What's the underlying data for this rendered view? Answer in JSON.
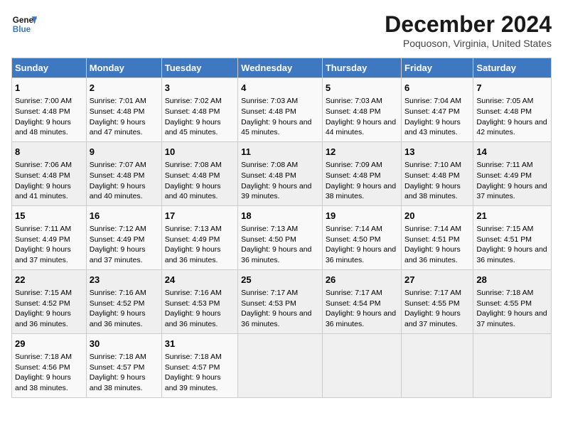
{
  "header": {
    "logo_line1": "General",
    "logo_line2": "Blue",
    "title": "December 2024",
    "subtitle": "Poquoson, Virginia, United States"
  },
  "days_of_week": [
    "Sunday",
    "Monday",
    "Tuesday",
    "Wednesday",
    "Thursday",
    "Friday",
    "Saturday"
  ],
  "weeks": [
    [
      {
        "day": "1",
        "sunrise": "Sunrise: 7:00 AM",
        "sunset": "Sunset: 4:48 PM",
        "daylight": "Daylight: 9 hours and 48 minutes."
      },
      {
        "day": "2",
        "sunrise": "Sunrise: 7:01 AM",
        "sunset": "Sunset: 4:48 PM",
        "daylight": "Daylight: 9 hours and 47 minutes."
      },
      {
        "day": "3",
        "sunrise": "Sunrise: 7:02 AM",
        "sunset": "Sunset: 4:48 PM",
        "daylight": "Daylight: 9 hours and 45 minutes."
      },
      {
        "day": "4",
        "sunrise": "Sunrise: 7:03 AM",
        "sunset": "Sunset: 4:48 PM",
        "daylight": "Daylight: 9 hours and 45 minutes."
      },
      {
        "day": "5",
        "sunrise": "Sunrise: 7:03 AM",
        "sunset": "Sunset: 4:48 PM",
        "daylight": "Daylight: 9 hours and 44 minutes."
      },
      {
        "day": "6",
        "sunrise": "Sunrise: 7:04 AM",
        "sunset": "Sunset: 4:47 PM",
        "daylight": "Daylight: 9 hours and 43 minutes."
      },
      {
        "day": "7",
        "sunrise": "Sunrise: 7:05 AM",
        "sunset": "Sunset: 4:48 PM",
        "daylight": "Daylight: 9 hours and 42 minutes."
      }
    ],
    [
      {
        "day": "8",
        "sunrise": "Sunrise: 7:06 AM",
        "sunset": "Sunset: 4:48 PM",
        "daylight": "Daylight: 9 hours and 41 minutes."
      },
      {
        "day": "9",
        "sunrise": "Sunrise: 7:07 AM",
        "sunset": "Sunset: 4:48 PM",
        "daylight": "Daylight: 9 hours and 40 minutes."
      },
      {
        "day": "10",
        "sunrise": "Sunrise: 7:08 AM",
        "sunset": "Sunset: 4:48 PM",
        "daylight": "Daylight: 9 hours and 40 minutes."
      },
      {
        "day": "11",
        "sunrise": "Sunrise: 7:08 AM",
        "sunset": "Sunset: 4:48 PM",
        "daylight": "Daylight: 9 hours and 39 minutes."
      },
      {
        "day": "12",
        "sunrise": "Sunrise: 7:09 AM",
        "sunset": "Sunset: 4:48 PM",
        "daylight": "Daylight: 9 hours and 38 minutes."
      },
      {
        "day": "13",
        "sunrise": "Sunrise: 7:10 AM",
        "sunset": "Sunset: 4:48 PM",
        "daylight": "Daylight: 9 hours and 38 minutes."
      },
      {
        "day": "14",
        "sunrise": "Sunrise: 7:11 AM",
        "sunset": "Sunset: 4:49 PM",
        "daylight": "Daylight: 9 hours and 37 minutes."
      }
    ],
    [
      {
        "day": "15",
        "sunrise": "Sunrise: 7:11 AM",
        "sunset": "Sunset: 4:49 PM",
        "daylight": "Daylight: 9 hours and 37 minutes."
      },
      {
        "day": "16",
        "sunrise": "Sunrise: 7:12 AM",
        "sunset": "Sunset: 4:49 PM",
        "daylight": "Daylight: 9 hours and 37 minutes."
      },
      {
        "day": "17",
        "sunrise": "Sunrise: 7:13 AM",
        "sunset": "Sunset: 4:49 PM",
        "daylight": "Daylight: 9 hours and 36 minutes."
      },
      {
        "day": "18",
        "sunrise": "Sunrise: 7:13 AM",
        "sunset": "Sunset: 4:50 PM",
        "daylight": "Daylight: 9 hours and 36 minutes."
      },
      {
        "day": "19",
        "sunrise": "Sunrise: 7:14 AM",
        "sunset": "Sunset: 4:50 PM",
        "daylight": "Daylight: 9 hours and 36 minutes."
      },
      {
        "day": "20",
        "sunrise": "Sunrise: 7:14 AM",
        "sunset": "Sunset: 4:51 PM",
        "daylight": "Daylight: 9 hours and 36 minutes."
      },
      {
        "day": "21",
        "sunrise": "Sunrise: 7:15 AM",
        "sunset": "Sunset: 4:51 PM",
        "daylight": "Daylight: 9 hours and 36 minutes."
      }
    ],
    [
      {
        "day": "22",
        "sunrise": "Sunrise: 7:15 AM",
        "sunset": "Sunset: 4:52 PM",
        "daylight": "Daylight: 9 hours and 36 minutes."
      },
      {
        "day": "23",
        "sunrise": "Sunrise: 7:16 AM",
        "sunset": "Sunset: 4:52 PM",
        "daylight": "Daylight: 9 hours and 36 minutes."
      },
      {
        "day": "24",
        "sunrise": "Sunrise: 7:16 AM",
        "sunset": "Sunset: 4:53 PM",
        "daylight": "Daylight: 9 hours and 36 minutes."
      },
      {
        "day": "25",
        "sunrise": "Sunrise: 7:17 AM",
        "sunset": "Sunset: 4:53 PM",
        "daylight": "Daylight: 9 hours and 36 minutes."
      },
      {
        "day": "26",
        "sunrise": "Sunrise: 7:17 AM",
        "sunset": "Sunset: 4:54 PM",
        "daylight": "Daylight: 9 hours and 36 minutes."
      },
      {
        "day": "27",
        "sunrise": "Sunrise: 7:17 AM",
        "sunset": "Sunset: 4:55 PM",
        "daylight": "Daylight: 9 hours and 37 minutes."
      },
      {
        "day": "28",
        "sunrise": "Sunrise: 7:18 AM",
        "sunset": "Sunset: 4:55 PM",
        "daylight": "Daylight: 9 hours and 37 minutes."
      }
    ],
    [
      {
        "day": "29",
        "sunrise": "Sunrise: 7:18 AM",
        "sunset": "Sunset: 4:56 PM",
        "daylight": "Daylight: 9 hours and 38 minutes."
      },
      {
        "day": "30",
        "sunrise": "Sunrise: 7:18 AM",
        "sunset": "Sunset: 4:57 PM",
        "daylight": "Daylight: 9 hours and 38 minutes."
      },
      {
        "day": "31",
        "sunrise": "Sunrise: 7:18 AM",
        "sunset": "Sunset: 4:57 PM",
        "daylight": "Daylight: 9 hours and 39 minutes."
      },
      null,
      null,
      null,
      null
    ]
  ]
}
